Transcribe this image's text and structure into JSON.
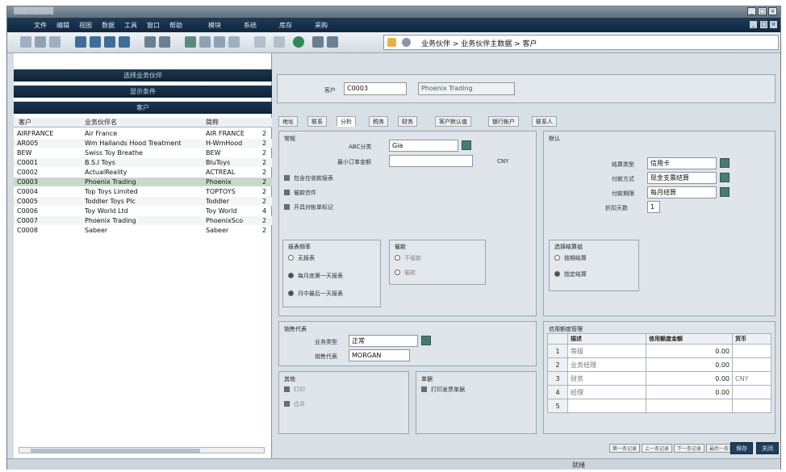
{
  "window": {
    "title": "▒▒▒▒▒▒▒▒"
  },
  "menu": {
    "items": [
      "文件",
      "编辑",
      "视图",
      "数据",
      "工具",
      "窗口",
      "帮助",
      "模块",
      "系统",
      "库存",
      "采购"
    ]
  },
  "breadcrumb": {
    "text": "业务伙伴 > 业务伙伴主数据 > 客户"
  },
  "left_panel": {
    "bars": [
      "选择业务伙伴",
      "显示条件",
      "客户"
    ],
    "columns": [
      "客户",
      "业务伙伴名",
      "简称",
      ""
    ],
    "rows": [
      {
        "code": "AIRFRANCE",
        "name": "Air France",
        "short": "AIR FRANCE",
        "x": "2"
      },
      {
        "code": "AR005",
        "name": "Wm Hallands Hood Treatment",
        "short": "H-WmHood",
        "x": "2"
      },
      {
        "code": "BEW",
        "name": "Swiss Toy Breathe",
        "short": "BEW",
        "x": "2"
      },
      {
        "code": "C0001",
        "name": "B.S.I Toys",
        "short": "BluToys",
        "x": "2"
      },
      {
        "code": "C0002",
        "name": "ActualReality",
        "short": "ACTREAL",
        "x": "2"
      },
      {
        "code": "C0003",
        "name": "Phoenix Trading",
        "short": "Phoenix",
        "x": "2"
      },
      {
        "code": "C0004",
        "name": "Top Toys Limited",
        "short": "TOPTOYS",
        "x": "2"
      },
      {
        "code": "C0005",
        "name": "Toddler Toys Plc",
        "short": "Toddler",
        "x": "2"
      },
      {
        "code": "C0006",
        "name": "Toy World Ltd",
        "short": "Toy World",
        "x": "4"
      },
      {
        "code": "C0007",
        "name": "Phoenix Trading",
        "short": "PhoenixSco",
        "x": "2"
      },
      {
        "code": "C0008",
        "name": "Sabeer",
        "short": "Sabeer",
        "x": "2"
      }
    ]
  },
  "header": {
    "customer_label": "客户",
    "customer_code": "C0003",
    "customer_name": "Phoenix Trading"
  },
  "tabs": [
    "地址",
    "联系",
    "分析",
    "税务",
    "财务",
    "客户默认值",
    "银行帐户",
    "联系人"
  ],
  "general": {
    "title": "常规",
    "abc_label": "ABC分类",
    "abc_value": "Gia",
    "credit_label": "最小订单金额",
    "credit_value": "",
    "currency": "CNY",
    "checks": [
      "包含在收款报表",
      "催款信件",
      "开具对帐单标记"
    ],
    "stmt_group": {
      "title": "报表频率",
      "options": [
        "无报表",
        "每月底第一天报表",
        "月中最后一天报表"
      ]
    },
    "mid_group": {
      "title": "催款",
      "options": [
        "不催款",
        "催款"
      ]
    }
  },
  "defaults": {
    "title": "默认",
    "fields": [
      {
        "label": "结算类型",
        "value": "信用卡"
      },
      {
        "label": "付款方式",
        "value": "现金支票结算"
      },
      {
        "label": "付款期限",
        "value": "每月结算"
      },
      {
        "label": "折扣天数",
        "value": "1"
      }
    ],
    "pay_group": {
      "title": "选择结算组",
      "options": [
        "按期结算",
        "指定结算"
      ]
    }
  },
  "sales": {
    "title": "销售代表",
    "fields": [
      {
        "label": "业务类型",
        "value": "正常"
      },
      {
        "label": "销售代表",
        "value": "MORGAN"
      }
    ]
  },
  "misc_left": {
    "title": "其他",
    "checks": [
      "打印",
      "合并"
    ]
  },
  "misc_right": {
    "title": "单据",
    "checks": [
      "打印发票单据"
    ]
  },
  "credit_table": {
    "title": "信用额度管理",
    "headers": [
      "",
      "描述",
      "信用额度金额",
      "货币"
    ],
    "rows": [
      {
        "n": "1",
        "desc": "等级",
        "amount": "0.00",
        "cur": ""
      },
      {
        "n": "2",
        "desc": "业务经理",
        "amount": "0.00",
        "cur": ""
      },
      {
        "n": "3",
        "desc": "财务",
        "amount": "0.00",
        "cur": "CNY"
      },
      {
        "n": "4",
        "desc": "经理",
        "amount": "0.00",
        "cur": ""
      },
      {
        "n": "5",
        "desc": "",
        "amount": "",
        "cur": ""
      }
    ]
  },
  "nav_buttons": [
    "第一条记录",
    "上一条记录",
    "下一条记录",
    "最后一条记录"
  ],
  "action_buttons": [
    "保存",
    "关闭"
  ],
  "status": {
    "text": "就绪"
  },
  "colors": {
    "dark": "#10273e",
    "panel": "#e3e8ec",
    "accent_btn": "#4a7a73",
    "selected_row": "#c9d8cc"
  }
}
